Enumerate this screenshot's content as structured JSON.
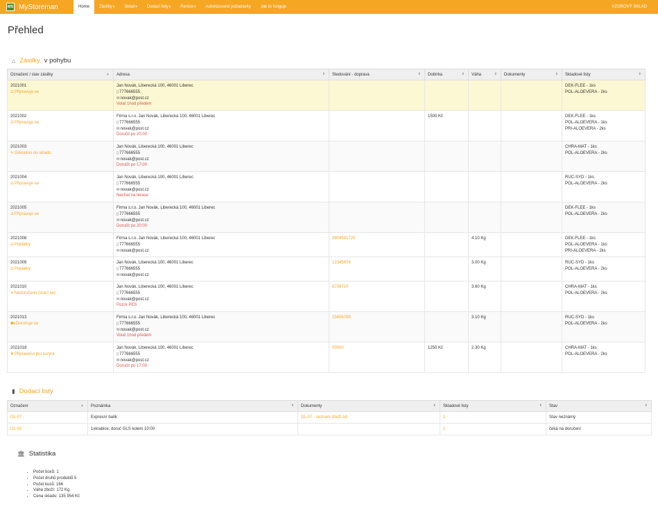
{
  "app": {
    "logo": "MS",
    "name": "MyStoreman",
    "account": "VZOROVÝ SKLAD"
  },
  "nav": [
    {
      "label": "Home",
      "caret": false,
      "active": true
    },
    {
      "label": "Zásilky",
      "caret": true
    },
    {
      "label": "Sklad",
      "caret": true
    },
    {
      "label": "Dodací listy",
      "caret": true
    },
    {
      "label": "Peníze",
      "caret": true
    },
    {
      "label": "Autorizované požadavky",
      "caret": false
    },
    {
      "label": "Jak to funguje",
      "caret": false
    }
  ],
  "page_title": "Přehled",
  "shipments": {
    "title_link": "Zásilky",
    "title_rest": "v pohybu",
    "icon": "home-icon",
    "columns": [
      "Označení / stav zásilky",
      "Adresa",
      "Sledování - doprava",
      "Dobírka",
      "Váha",
      "Dokumenty",
      "Skladové listy"
    ],
    "rows": [
      {
        "id": "2021001",
        "status": "Připravuje se",
        "status_icon": "list-icon",
        "address": "Jan Novák, Liberecká 100, 46001 Liberec",
        "phone": "777666555",
        "email": "novak@post.cz",
        "note": "Volat 1hod předem",
        "tracking": "",
        "cod": "",
        "weight": "",
        "docs": "",
        "sheets": [
          "DEK-FLEE - 1ks",
          "POL-ALOEVERA - 2ks"
        ]
      },
      {
        "id": "2021002",
        "status": "Připravuje se",
        "status_icon": "list-icon",
        "address": "Firma s.r.o. Jan Novák, Liberecká 100, 46001 Liberec",
        "phone": "777666555",
        "email": "novak@post.cz",
        "note": "Doručit po 20:00",
        "tracking": "",
        "cod": "1500 Kč",
        "weight": "",
        "docs": "",
        "sheets": [
          "DEK-FLEE - 1ks",
          "POL-ALOEVERA - 1ks",
          "PRI-ALOEVERA - 2ks"
        ]
      },
      {
        "id": "2021003",
        "status": "Odesláno do skladu",
        "status_icon": "paperclip-icon",
        "address": "Jan Novák, Liberecká 100, 46001 Liberec",
        "phone": "777666555",
        "email": "novak@post.cz",
        "note": "Doručit po 17:00",
        "tracking": "",
        "cod": "",
        "weight": "",
        "docs": "",
        "sheets": [
          "CHRA-MAT - 1ks",
          "POL-ALOEVERA - 2ks"
        ]
      },
      {
        "id": "2021004",
        "status": "Připravuje se",
        "status_icon": "list-icon",
        "address": "Jan Novák, Liberecká 100, 46001 Liberec",
        "phone": "777666555",
        "email": "novak@post.cz",
        "note": "Nechat na terase",
        "tracking": "",
        "cod": "",
        "weight": "",
        "docs": "",
        "sheets": [
          "RUC-SYD - 1ks",
          "POL-ALOEVERA - 2ks"
        ]
      },
      {
        "id": "2021005",
        "status": "Připravuje se",
        "status_icon": "list-icon",
        "address": "Firma s.r.o. Jan Novák, Liberecká 100, 46001 Liberec",
        "phone": "777666555",
        "email": "novak@post.cz",
        "note": "Doručit po 20:00",
        "tracking": "",
        "cod": "",
        "weight": "",
        "docs": "",
        "sheets": [
          "DEK-FLEE - 1ks",
          "POL-ALOEVERA - 2ks"
        ]
      },
      {
        "id": "2021008",
        "status": "Poplatky",
        "status_icon": "list-icon",
        "address": "Firma s.r.o. Jan Novák, Liberecká 100, 46001 Liberec",
        "phone": "777666555",
        "email": "novak@post.cz",
        "note": "",
        "tracking": "3904581720",
        "cod": "",
        "weight": "4.10 Kg",
        "docs": "",
        "sheets": [
          "DEK-FLEE - 1ks",
          "POL-ALOEVERA - 1ks",
          "PRI-ALOEVERA - 2ks"
        ]
      },
      {
        "id": "2021009",
        "status": "Poplatky",
        "status_icon": "list-icon",
        "address": "Jan Novák, Liberecká 100, 46001 Liberec",
        "phone": "777666555",
        "email": "novak@post.cz",
        "note": "",
        "tracking": "12345678",
        "cod": "",
        "weight": "3.00 Kg",
        "docs": "",
        "sheets": [
          "RUC-SYD - 1ks",
          "POL-ALOEVERA - 2ks"
        ]
      },
      {
        "id": "2021010",
        "status": "Nedoručeno (vrací se)",
        "status_icon": "close-icon",
        "address": "Jan Novák, Liberecká 100, 46001 Liberec",
        "phone": "777666555",
        "email": "novak@post.cz",
        "note": "Pozor PES",
        "tracking": "8739710",
        "cod": "",
        "weight": "3.60 Kg",
        "docs": "",
        "sheets": [
          "CHRA-MAT - 1ks",
          "POL-ALOEVERA - 2ks"
        ]
      },
      {
        "id": "2021013",
        "status": "Doručuje se",
        "status_icon": "truck-icon",
        "address": "Firma s.r.o. Jan Novák, Liberecká 100, 46001 Liberec",
        "phone": "777666555",
        "email": "novak@post.cz",
        "note": "Volat 1hod předem",
        "tracking": "23456789",
        "cod": "",
        "weight": "3.10 Kg",
        "docs": "",
        "sheets": [
          "RUC-SYD - 1ks",
          "POL-ALOEVERA - 2ks"
        ]
      },
      {
        "id": "2021018",
        "status": "Připraveno pro kurýra",
        "status_icon": "gift-icon",
        "address": "Jan Novák, Liberecká 100, 46001 Liberec",
        "phone": "777666555",
        "email": "novak@post.cz",
        "note": "Doručit po 17:00",
        "tracking": "00000",
        "cod": "1250 Kč",
        "weight": "2.30 Kg",
        "docs": "",
        "sheets": [
          "CHRA-MAT - 1ks",
          "POL-ALOEVERA - 2ks"
        ]
      }
    ]
  },
  "delivery": {
    "title": "Dodací listy",
    "icon": "document-icon",
    "columns": [
      "Označení",
      "Poznámka",
      "Dokumenty",
      "Skladové listy",
      "Stav"
    ],
    "rows": [
      {
        "id": "DL-07",
        "note": "Expresní balík",
        "doc": "DL-07 - seznam zboží.txt",
        "sheets": "1",
        "state": "Stav neznámý"
      },
      {
        "id": "DL 09",
        "note": "1xkrabice, doruč GLS kolem 10:00",
        "doc": "",
        "sheets": "1",
        "state": "čeká na doručení"
      }
    ]
  },
  "stats": {
    "title": "Statistika",
    "icon": "bank-icon",
    "items": [
      "Počet boxů: 1",
      "Počet druhů produktů 5",
      "Počet kusů: 166",
      "Váha zboží: 172 Kg",
      "Cena skladu: 135 954 Kč"
    ]
  }
}
